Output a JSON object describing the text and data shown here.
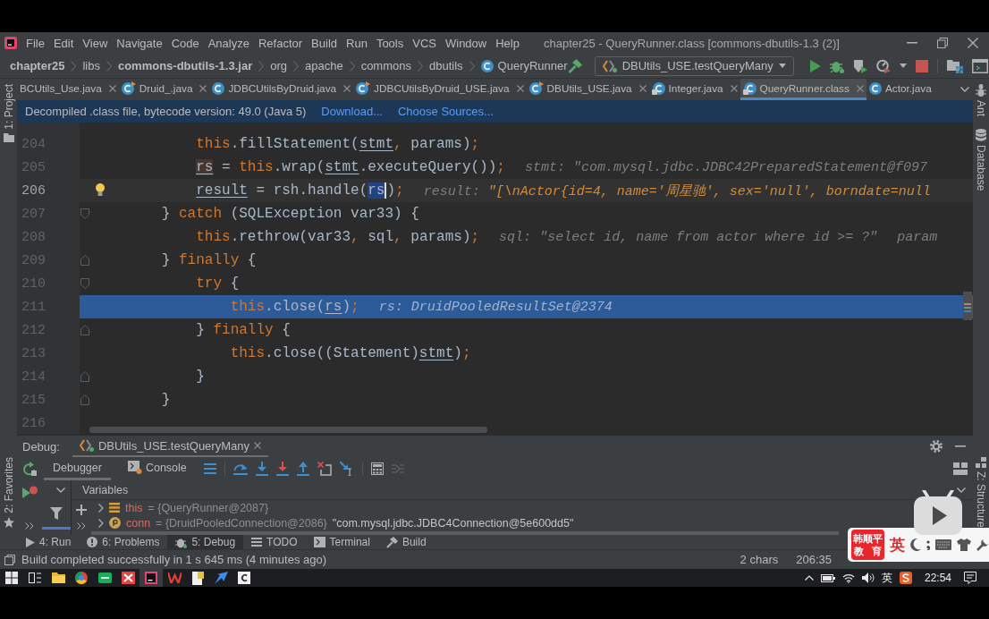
{
  "menu_bar": {
    "items": [
      "File",
      "Edit",
      "View",
      "Navigate",
      "Code",
      "Analyze",
      "Refactor",
      "Build",
      "Run",
      "Tools",
      "VCS",
      "Window",
      "Help"
    ],
    "title": "chapter25 - QueryRunner.class [commons-dbutils-1.3 (2)]"
  },
  "nav_bar": {
    "breadcrumbs": [
      {
        "label": "chapter25",
        "kind": "project"
      },
      {
        "label": "libs",
        "kind": "folder"
      },
      {
        "label": "commons-dbutils-1.3.jar",
        "kind": "jar"
      },
      {
        "label": "org",
        "kind": "folder"
      },
      {
        "label": "apache",
        "kind": "folder"
      },
      {
        "label": "commons",
        "kind": "folder"
      },
      {
        "label": "dbutils",
        "kind": "folder"
      },
      {
        "label": "QueryRunner",
        "kind": "class"
      }
    ],
    "run_config": "DBUtils_USE.testQueryMany"
  },
  "left_strip": {
    "top": [
      {
        "label": "1: Project",
        "kind": "folder"
      }
    ],
    "bottom": [
      {
        "label": "2: Favorites",
        "kind": "star"
      }
    ]
  },
  "right_strip": {
    "top": [
      {
        "label": "Ant",
        "kind": "ant"
      },
      {
        "label": "Database",
        "kind": "database"
      }
    ],
    "bottom": [
      {
        "label": "Z: Structure",
        "kind": "structure"
      }
    ]
  },
  "editor_tabs": [
    {
      "label": "BCUtils_Use.java",
      "kind": "plain",
      "closable": true,
      "selected": false
    },
    {
      "label": "Druid_.java",
      "kind": "runnable",
      "closable": true,
      "selected": false
    },
    {
      "label": "JDBCUtilsByDruid.java",
      "kind": "class",
      "closable": true,
      "selected": false
    },
    {
      "label": "JDBCUtilsByDruid_USE.java",
      "kind": "runnable",
      "closable": true,
      "selected": false
    },
    {
      "label": "DBUtils_USE.java",
      "kind": "runnable",
      "closable": true,
      "selected": false
    },
    {
      "label": "Integer.java",
      "kind": "library",
      "closable": true,
      "selected": false
    },
    {
      "label": "QueryRunner.class",
      "kind": "library",
      "closable": true,
      "selected": true
    },
    {
      "label": "Actor.java",
      "kind": "class",
      "closable": false,
      "selected": false
    }
  ],
  "banner": {
    "text": "Decompiled .class file, bytecode version: 49.0 (Java 5)",
    "links": [
      "Download...",
      "Choose Sources..."
    ]
  },
  "editor": {
    "lines": [
      {
        "number": "204",
        "kind": "plain",
        "current": false,
        "execution": false,
        "bulb": false,
        "tokens": [
          {
            "kind": "keyword",
            "text": "            this"
          },
          {
            "kind": "plain",
            "text": ".fillStatement("
          },
          {
            "kind": "reassigned",
            "text": "stmt"
          },
          {
            "kind": "punct",
            "text": ","
          },
          {
            "kind": "plain",
            "text": " params)"
          },
          {
            "kind": "punct",
            "text": ";"
          }
        ]
      },
      {
        "number": "205",
        "kind": "plain",
        "current": false,
        "execution": false,
        "bulb": false,
        "tokens": [
          {
            "kind": "write",
            "text": "            rs"
          },
          {
            "kind": "plain",
            "text": " = "
          },
          {
            "kind": "keyword",
            "text": "this"
          },
          {
            "kind": "plain",
            "text": ".wrap("
          },
          {
            "kind": "reassigned",
            "text": "stmt"
          },
          {
            "kind": "plain",
            "text": ".executeQuery())"
          },
          {
            "kind": "punct",
            "text": ";"
          }
        ],
        "hints": [
          {
            "label": "stmt:",
            "value": "\"com.mysql.jdbc.JDBC42PreparedStatement@f097",
            "changed": false
          }
        ]
      },
      {
        "number": "206",
        "kind": "plain",
        "current": true,
        "execution": false,
        "bulb": true,
        "tokens": [
          {
            "kind": "reassigned",
            "text": "            result"
          },
          {
            "kind": "plain",
            "text": " = rsh.handle("
          },
          {
            "kind": "selected",
            "text": "rs"
          },
          {
            "kind": "plain",
            "text": ")"
          },
          {
            "kind": "punct",
            "text": ";"
          }
        ],
        "hints": [
          {
            "label": "result:",
            "value": "\"[\\nActor{id=4, name='周星驰', sex='null', borndate=null",
            "changed": true
          }
        ]
      },
      {
        "number": "207",
        "kind": "fold-start",
        "current": false,
        "execution": false,
        "bulb": false,
        "tokens": [
          {
            "kind": "plain",
            "text": "        } "
          },
          {
            "kind": "keyword",
            "text": "catch"
          },
          {
            "kind": "plain",
            "text": " (SQLException var33) {"
          }
        ]
      },
      {
        "number": "208",
        "kind": "plain",
        "current": false,
        "execution": false,
        "bulb": false,
        "tokens": [
          {
            "kind": "keyword",
            "text": "            this"
          },
          {
            "kind": "plain",
            "text": ".rethrow(var33"
          },
          {
            "kind": "punct",
            "text": ","
          },
          {
            "kind": "plain",
            "text": " sql"
          },
          {
            "kind": "punct",
            "text": ","
          },
          {
            "kind": "plain",
            "text": " params)"
          },
          {
            "kind": "punct",
            "text": ";"
          }
        ],
        "hints": [
          {
            "label": "sql:",
            "value": "\"select id, name from actor where id >= ?\"",
            "changed": false
          },
          {
            "label": "param",
            "changed": false
          }
        ]
      },
      {
        "number": "209",
        "kind": "fold-end",
        "current": false,
        "execution": false,
        "bulb": false,
        "tokens": [
          {
            "kind": "plain",
            "text": "        } "
          },
          {
            "kind": "keyword",
            "text": "finally"
          },
          {
            "kind": "plain",
            "text": " {"
          }
        ]
      },
      {
        "number": "210",
        "kind": "fold-start",
        "current": false,
        "execution": false,
        "bulb": false,
        "tokens": [
          {
            "kind": "keyword",
            "text": "            try"
          },
          {
            "kind": "plain",
            "text": " {"
          }
        ]
      },
      {
        "number": "211",
        "kind": "plain",
        "current": false,
        "execution": true,
        "bulb": false,
        "tokens": [
          {
            "kind": "keyword",
            "text": "                this"
          },
          {
            "kind": "plain",
            "text": ".close("
          },
          {
            "kind": "reassigned",
            "text": "rs"
          },
          {
            "kind": "plain",
            "text": ")"
          },
          {
            "kind": "punct",
            "text": ";"
          }
        ],
        "hints": [
          {
            "label": "rs:",
            "value": "DruidPooledResultSet@2374",
            "changed": false
          }
        ]
      },
      {
        "number": "212",
        "kind": "fold-end",
        "current": false,
        "execution": false,
        "bulb": false,
        "tokens": [
          {
            "kind": "plain",
            "text": "            } "
          },
          {
            "kind": "keyword",
            "text": "finally"
          },
          {
            "kind": "plain",
            "text": " {"
          }
        ]
      },
      {
        "number": "213",
        "kind": "plain",
        "current": false,
        "execution": false,
        "bulb": false,
        "tokens": [
          {
            "kind": "keyword",
            "text": "                this"
          },
          {
            "kind": "plain",
            "text": ".close((Statement)"
          },
          {
            "kind": "reassigned",
            "text": "stmt"
          },
          {
            "kind": "plain",
            "text": ")"
          },
          {
            "kind": "punct",
            "text": ";"
          }
        ]
      },
      {
        "number": "214",
        "kind": "fold-end",
        "current": false,
        "execution": false,
        "bulb": false,
        "tokens": [
          {
            "kind": "plain",
            "text": "            }"
          }
        ]
      },
      {
        "number": "215",
        "kind": "fold-end",
        "current": false,
        "execution": false,
        "bulb": false,
        "tokens": [
          {
            "kind": "plain",
            "text": "        }"
          }
        ]
      },
      {
        "number": "216",
        "kind": "plain",
        "current": false,
        "execution": false,
        "bulb": false
      }
    ]
  },
  "debug_panel": {
    "title": "Debug:",
    "session": "DBUtils_USE.testQueryMany",
    "tabs": [
      {
        "label": "Debugger",
        "selected": true
      },
      {
        "label": "Console",
        "selected": false
      }
    ],
    "variables_title": "Variables",
    "variables": [
      {
        "kind": "fields",
        "name": "this",
        "value": "= {QueryRunner@2087}"
      },
      {
        "kind": "parameter",
        "name": "conn",
        "value": "= {DruidPooledConnection@2086}",
        "string": "\"com.mysql.jdbc.JDBC4Connection@5e600dd5\""
      }
    ]
  },
  "tool_windows": [
    {
      "label": "4: Run",
      "kind": "run",
      "selected": false
    },
    {
      "label": "6: Problems",
      "kind": "problems",
      "selected": false
    },
    {
      "label": "5: Debug",
      "kind": "debug",
      "selected": true
    },
    {
      "label": "TODO",
      "kind": "todo",
      "selected": false
    },
    {
      "label": "Terminal",
      "kind": "terminal",
      "selected": false
    },
    {
      "label": "Build",
      "kind": "build",
      "selected": false
    }
  ],
  "status_bar": {
    "message": "Build completed successfully in 1 s 645 ms (4 minutes ago)",
    "selection": "2 chars",
    "position": "206:35"
  },
  "taskbar": {
    "apps": [
      {
        "kind": "windows",
        "selected": false
      },
      {
        "kind": "task-view",
        "selected": false
      },
      {
        "kind": "folder",
        "selected": false
      },
      {
        "kind": "browser",
        "selected": false
      },
      {
        "kind": "green-tile",
        "selected": false
      },
      {
        "kind": "red-tile",
        "selected": false
      },
      {
        "kind": "ide",
        "selected": true
      },
      {
        "kind": "w-tile",
        "selected": false
      },
      {
        "kind": "notes",
        "selected": false
      },
      {
        "kind": "arrow",
        "selected": false
      },
      {
        "kind": "c-tile",
        "selected": false
      }
    ],
    "input_mode": "英",
    "clock": "22:54"
  },
  "ime_toolbar": {
    "logo": [
      "韩顺平",
      "教育"
    ],
    "mode": "英"
  }
}
